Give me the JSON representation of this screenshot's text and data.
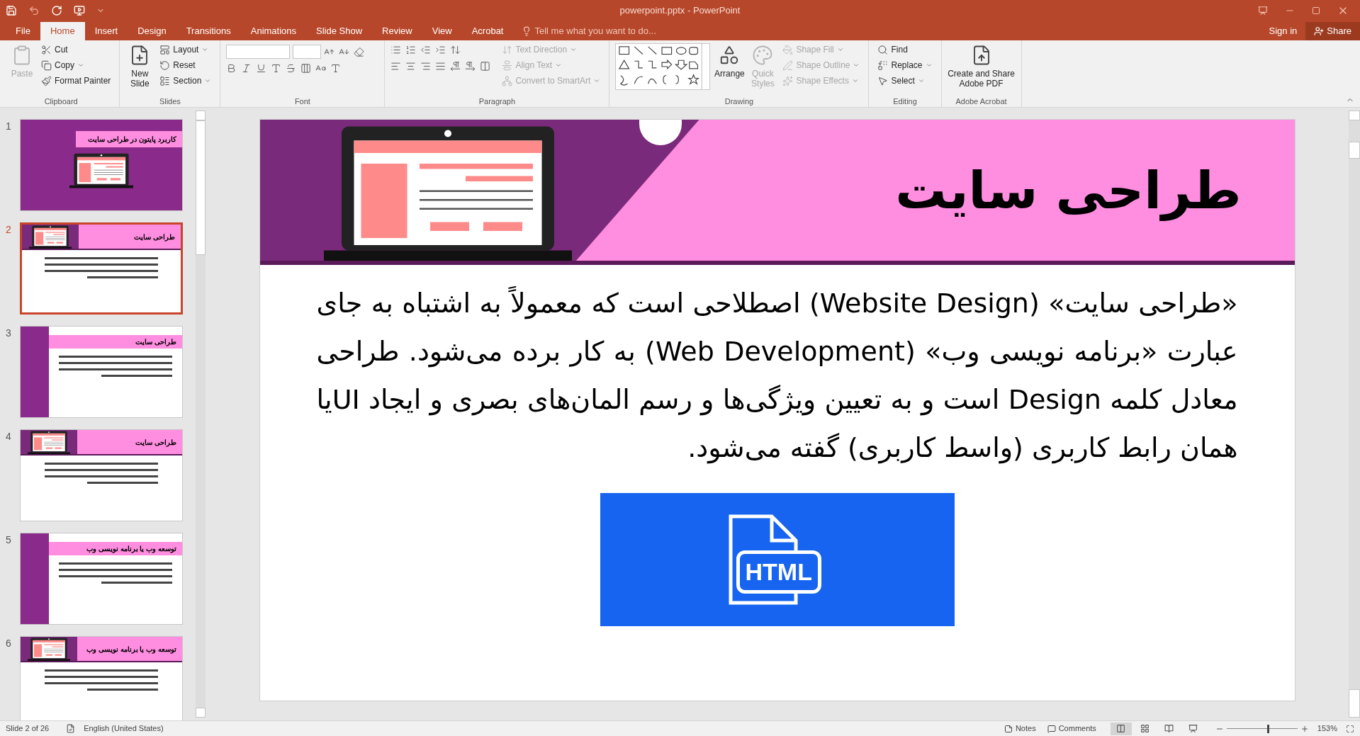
{
  "window": {
    "title": "powerpoint.pptx - PowerPoint"
  },
  "tabs": [
    {
      "label": "File",
      "selected": false
    },
    {
      "label": "Home",
      "selected": true
    },
    {
      "label": "Insert",
      "selected": false
    },
    {
      "label": "Design",
      "selected": false
    },
    {
      "label": "Transitions",
      "selected": false
    },
    {
      "label": "Animations",
      "selected": false
    },
    {
      "label": "Slide Show",
      "selected": false
    },
    {
      "label": "Review",
      "selected": false
    },
    {
      "label": "View",
      "selected": false
    },
    {
      "label": "Acrobat",
      "selected": false
    }
  ],
  "tell_me": "Tell me what you want to do...",
  "account": {
    "sign_in": "Sign in",
    "share": "Share"
  },
  "ribbon": [
    {
      "kind": "clipboard",
      "label": "Clipboard",
      "buttons": [
        {
          "label": "Paste",
          "disabled": true
        },
        {
          "label": "Cut",
          "disabled": false
        },
        {
          "label": "Copy",
          "disabled": false
        },
        {
          "label": "Format Painter",
          "disabled": false
        }
      ]
    },
    {
      "kind": "slides",
      "label": "Slides",
      "buttons": [
        {
          "label": "New Slide",
          "disabled": false
        },
        {
          "label": "Layout",
          "disabled": false
        },
        {
          "label": "Reset",
          "disabled": false
        },
        {
          "label": "Section",
          "disabled": false
        }
      ]
    },
    {
      "kind": "font",
      "label": "Font"
    },
    {
      "kind": "paragraph",
      "label": "Paragraph",
      "buttons": [
        {
          "label": "Text Direction",
          "disabled": true
        },
        {
          "label": "Align Text",
          "disabled": true
        },
        {
          "label": "Convert to SmartArt",
          "disabled": true
        }
      ]
    },
    {
      "kind": "drawing",
      "label": "Drawing",
      "buttons": [
        {
          "label": "Arrange",
          "disabled": false
        },
        {
          "label": "Quick Styles",
          "disabled": true
        },
        {
          "label": "Shape Fill",
          "disabled": true
        },
        {
          "label": "Shape Outline",
          "disabled": true
        },
        {
          "label": "Shape Effects",
          "disabled": true
        }
      ]
    },
    {
      "kind": "editing",
      "label": "Editing",
      "buttons": [
        {
          "label": "Find",
          "disabled": false
        },
        {
          "label": "Replace",
          "disabled": false
        },
        {
          "label": "Select",
          "disabled": false
        }
      ]
    },
    {
      "kind": "acrobat",
      "label": "Adobe Acrobat",
      "buttons": [
        {
          "label": "Create and Share Adobe PDF",
          "disabled": false
        }
      ]
    }
  ],
  "thumbnails": [
    {
      "number": "1",
      "title": "کاربرد پایتون در طراحی سایت",
      "kind": "cover",
      "selected": false
    },
    {
      "number": "2",
      "title": "طراحی سایت",
      "kind": "banner",
      "selected": true
    },
    {
      "number": "3",
      "title": "طراحی سایت",
      "kind": "side",
      "selected": false
    },
    {
      "number": "4",
      "title": "طراحی سایت",
      "kind": "banner",
      "selected": false
    },
    {
      "number": "5",
      "title": "توسعه وب یا برنامه نویسی وب",
      "kind": "side",
      "selected": false
    },
    {
      "number": "6",
      "title": "توسعه وب یا برنامه نویسی وب",
      "kind": "banner",
      "selected": false
    }
  ],
  "slide": {
    "title": "طراحی سایت",
    "body": "«طراحی سایت» (Website Design) اصطلاحی است که معمولاً به اشتباه به جای عبارت «برنامه نویسی وب» (Web Development) به کار برده می‌شود. طراحی معادل کلمه Design است و به تعیین ویژگی‌ها و رسم المان‌های بصری و ایجاد  UIیا همان رابط کاربری (واسط کاربری) گفته می‌شود.",
    "image_label": "HTML"
  },
  "status_bar": {
    "slide_info": "Slide 2 of 26",
    "language": "English (United States)",
    "notes": "Notes",
    "comments": "Comments",
    "views": [
      {
        "selected": true
      },
      {
        "selected": false
      },
      {
        "selected": false
      },
      {
        "selected": false
      }
    ],
    "zoom_slider": {
      "level": 0.58
    },
    "zoom": "153%"
  }
}
